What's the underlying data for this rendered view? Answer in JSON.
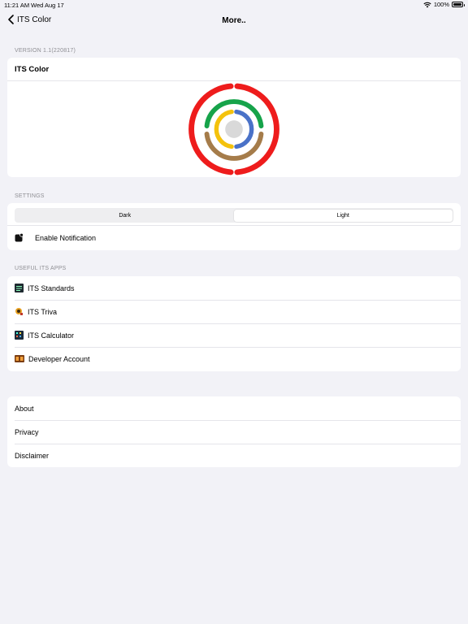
{
  "status": {
    "time": "11:21 AM",
    "date": "Wed Aug 17",
    "battery": "100%",
    "battery_level": 1.0
  },
  "nav": {
    "back_label": "ITS Color",
    "title": "More.."
  },
  "version_section": {
    "header": "VERSION 1.1(220817)",
    "app_name": "ITS Color"
  },
  "settings": {
    "header": "SETTINGS",
    "segments": [
      "Dark",
      "Light"
    ],
    "selected": "Light",
    "notification_label": "Enable Notification"
  },
  "apps": {
    "header": "USEFUL ITS APPS",
    "items": [
      {
        "label": "ITS Standards",
        "icon": "its-standards-icon"
      },
      {
        "label": "ITS Triva",
        "icon": "its-triva-icon"
      },
      {
        "label": "ITS Calculator",
        "icon": "its-calculator-icon"
      },
      {
        "label": "Developer Account",
        "icon": "developer-account-icon"
      }
    ]
  },
  "info": {
    "items": [
      "About",
      "Privacy",
      "Disclaimer"
    ]
  },
  "colors": {
    "ring_red": "#ee1c1c",
    "ring_green": "#16a34a",
    "ring_blue": "#4a72c8",
    "ring_yellow": "#f4c20d",
    "ring_brown": "#a57c4a",
    "center_gray": "#d9d9d9"
  }
}
